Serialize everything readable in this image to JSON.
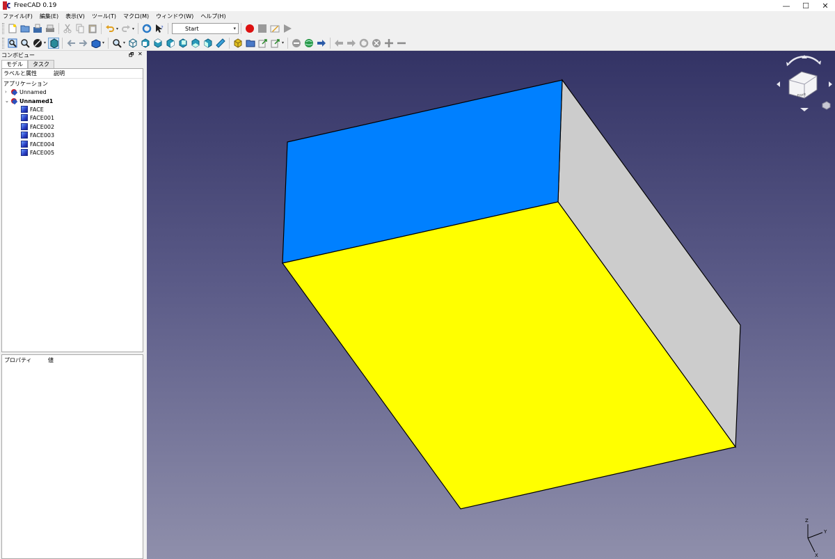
{
  "window": {
    "title": "FreeCAD 0.19",
    "minimize_glyph": "—",
    "maximize_glyph": "☐",
    "close_glyph": "✕"
  },
  "menu": [
    "ファイル(F)",
    "編集(E)",
    "表示(V)",
    "ツール(T)",
    "マクロ(M)",
    "ウィンドウ(W)",
    "ヘルプ(H)"
  ],
  "toolbar": {
    "workbench_selector": "Start",
    "icons_row1": [
      "new-file-icon",
      "open-file-icon",
      "save-icon",
      "print-icon",
      "cut-icon",
      "copy-icon",
      "paste-icon",
      "undo-icon",
      "redo-icon",
      "refresh-icon",
      "whats-this-icon",
      "macro-record-icon",
      "macro-stop-icon",
      "macro-edit-icon",
      "macro-run-icon"
    ],
    "icons_row2": [
      "fit-all-icon",
      "fit-selection-icon",
      "draw-style-icon",
      "bounding-box-icon",
      "back-icon",
      "forward-icon",
      "std-views-icon",
      "zoom-icon",
      "view-iso-icon",
      "view-front-icon",
      "view-top-icon",
      "view-right-icon",
      "view-rear-icon",
      "view-bottom-icon",
      "view-left-icon",
      "measure-icon",
      "part-icon",
      "group-icon",
      "link-icon",
      "link-actions-icon",
      "no-entry-icon",
      "web-home-icon",
      "web-go-icon",
      "web-back-icon",
      "web-forward-icon",
      "web-refresh-icon",
      "web-stop-icon",
      "zoom-in-icon",
      "zoom-out-icon"
    ]
  },
  "combo_view": {
    "title": "コンボビュー",
    "float_glyph": "🗗",
    "close_glyph": "✕",
    "tabs": [
      "モデル",
      "タスク"
    ],
    "tree_columns": [
      "ラベルと属性",
      "説明"
    ],
    "root_label": "アプリケーション",
    "documents": [
      {
        "label": "Unnamed",
        "expanded": false,
        "bold": false
      },
      {
        "label": "Unnamed1",
        "expanded": true,
        "bold": true
      }
    ],
    "objects": [
      "FACE",
      "FACE001",
      "FACE002",
      "FACE003",
      "FACE004",
      "FACE005"
    ],
    "expander_collapsed": "›",
    "expander_expanded": "⌄",
    "property_columns": [
      "プロパティ",
      "値"
    ]
  },
  "view3d": {
    "face_colors": {
      "top": "#0080ff",
      "bottom": "#ffff00",
      "side": "#cccccc"
    },
    "navcube_label": "Front",
    "axis_labels": [
      "Z",
      "Y",
      "X"
    ]
  }
}
